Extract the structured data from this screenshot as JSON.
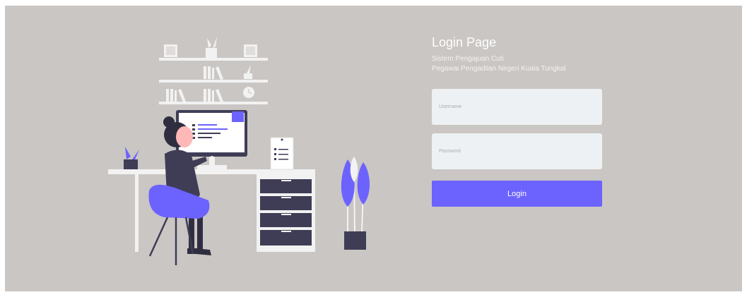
{
  "login": {
    "title": "Login Page",
    "subtitle_line1": "Sistem Pengajuan Cuti",
    "subtitle_line2": "Pegawai Pengadilan Negeri Kuala Tungkal",
    "username_placeholder": "Username",
    "password_placeholder": "Password",
    "button_label": "Login"
  },
  "colors": {
    "background": "#cac6c3",
    "accent": "#6c63ff",
    "field_background": "#edf1f3",
    "dark": "#3f3d56"
  }
}
